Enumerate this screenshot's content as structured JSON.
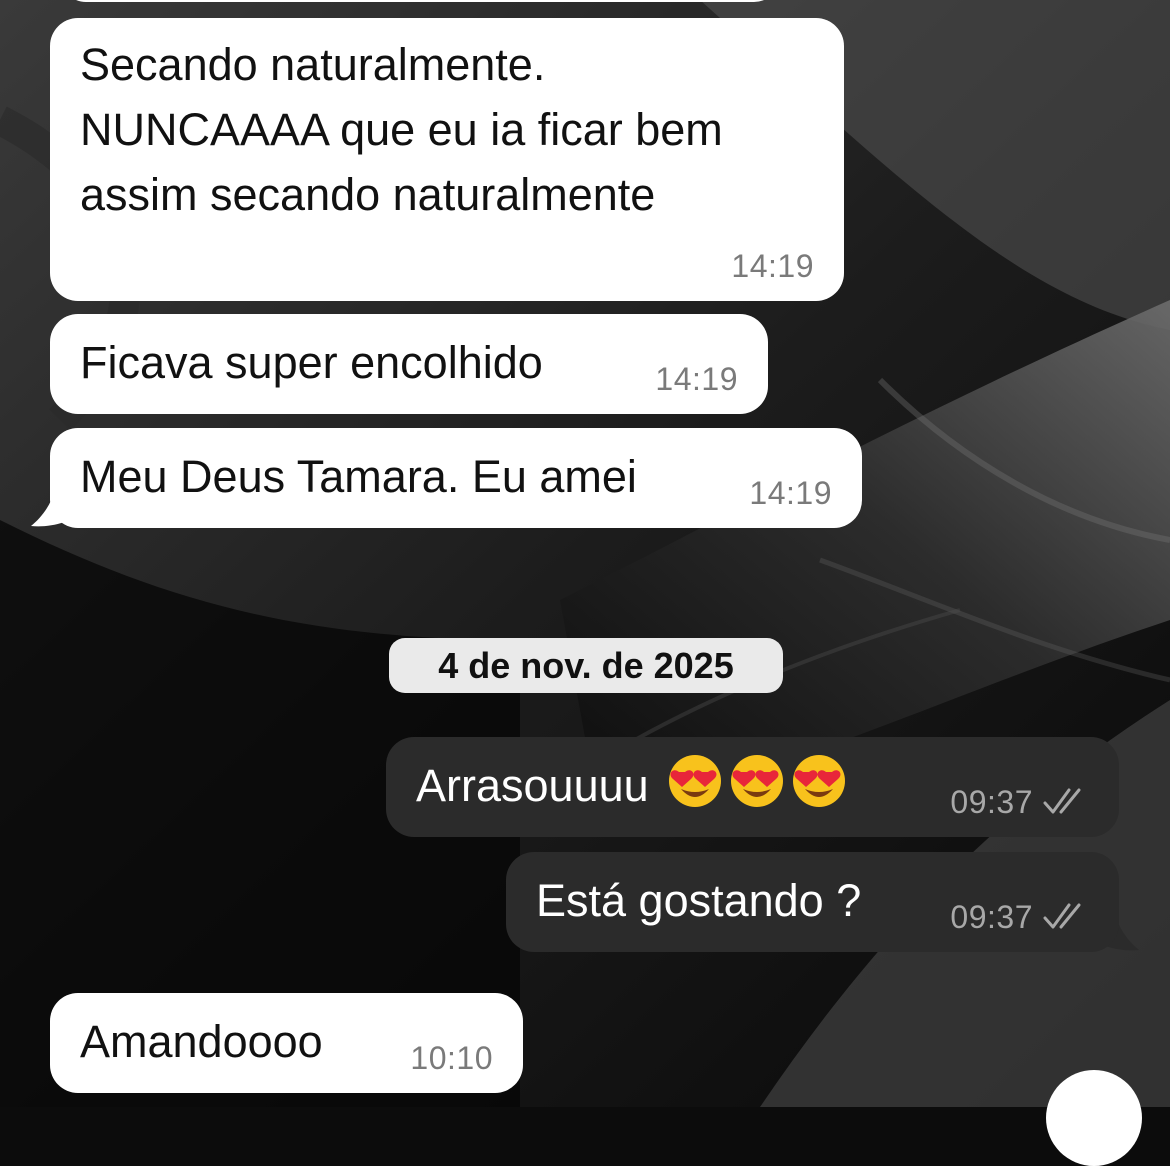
{
  "date_separator": "4 de nov. de 2025",
  "messages": [
    {
      "direction": "incoming",
      "lines": [
        "Secando naturalmente.",
        "NUNCAAAA que eu ia ficar bem",
        "assim secando naturalmente"
      ],
      "time": "14:19"
    },
    {
      "direction": "incoming",
      "text": "Ficava super encolhido",
      "time": "14:19"
    },
    {
      "direction": "incoming",
      "text": "Meu Deus Tamara. Eu amei",
      "time": "14:19"
    },
    {
      "direction": "outgoing",
      "text": "Arrasouuuu",
      "emojis": [
        "heart-eyes-emoji",
        "heart-eyes-emoji",
        "heart-eyes-emoji"
      ],
      "time": "09:37",
      "status": "read-double-check"
    },
    {
      "direction": "outgoing",
      "text": "Está gostando ?",
      "time": "09:37",
      "status": "read-double-check"
    },
    {
      "direction": "incoming",
      "text": "Amandoooo",
      "time": "10:10"
    }
  ],
  "colors": {
    "incoming_bubble": "#ffffff",
    "outgoing_bubble": "#2b2b2b",
    "date_chip": "#eaeaea",
    "wallpaper": "#0c0c0c"
  },
  "wallpaper": "dark-sand-dune-texture",
  "scroll_button_icon": "chevron-down-icon"
}
